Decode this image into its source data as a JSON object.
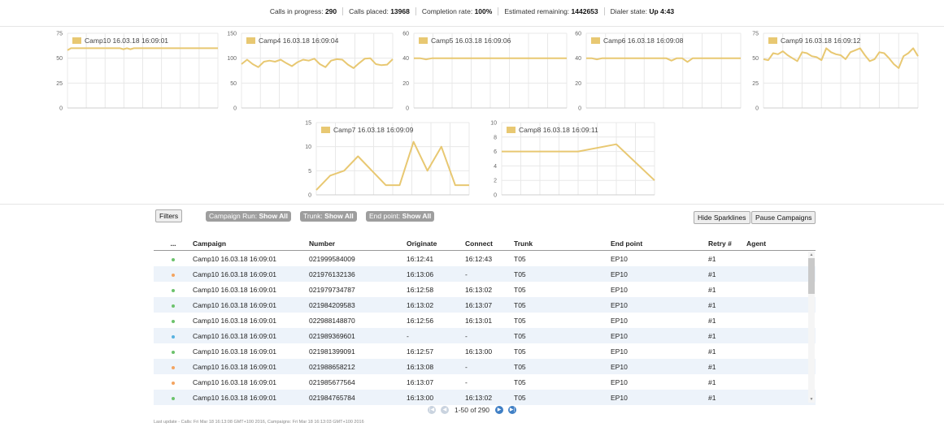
{
  "status": {
    "calls_in_progress_label": "Calls in progress:",
    "calls_in_progress": "290",
    "calls_placed_label": "Calls placed:",
    "calls_placed": "13968",
    "completion_rate_label": "Completion rate:",
    "completion_rate": "100%",
    "estimated_remaining_label": "Estimated remaining:",
    "estimated_remaining": "1442653",
    "dialer_state_label": "Dialer state:",
    "dialer_state": "Up 4:43"
  },
  "sparklines": [
    {
      "legend": "Camp10 16.03.18 16:09:01",
      "ymax": 75,
      "yticks": [
        0,
        25,
        50,
        75
      ],
      "color": "#e8c872",
      "values": [
        58,
        60,
        60,
        60,
        60,
        60,
        60,
        60,
        60,
        60,
        60,
        60,
        60,
        60,
        60,
        60,
        59,
        60,
        59,
        60,
        60,
        60,
        60,
        60,
        60,
        60,
        60,
        60,
        60,
        60,
        60,
        60,
        60,
        60,
        60,
        60,
        60,
        60,
        60,
        60,
        60,
        60,
        60,
        60
      ]
    },
    {
      "legend": "Camp4 16.03.18 16:09:04",
      "ymax": 150,
      "yticks": [
        0,
        50,
        100,
        150
      ],
      "color": "#e8c872",
      "values": [
        88,
        97,
        88,
        82,
        93,
        95,
        93,
        97,
        90,
        84,
        92,
        97,
        95,
        99,
        88,
        82,
        95,
        98,
        97,
        87,
        80,
        90,
        99,
        100,
        88,
        86,
        87,
        98
      ]
    },
    {
      "legend": "Camp5 16.03.18 16:09:06",
      "ymax": 60,
      "yticks": [
        0,
        20,
        40,
        60
      ],
      "color": "#e8c872",
      "values": [
        40,
        40,
        39,
        40,
        40,
        40,
        40,
        40,
        40,
        40,
        40,
        40,
        40,
        40,
        40,
        40,
        40,
        40,
        40,
        40,
        40,
        40,
        40,
        40,
        40,
        40
      ]
    },
    {
      "legend": "Camp6 16.03.18 16:09:08",
      "ymax": 60,
      "yticks": [
        0,
        20,
        40,
        60
      ],
      "color": "#e8c872",
      "values": [
        40,
        40,
        39,
        40,
        40,
        40,
        40,
        40,
        40,
        40,
        40,
        40,
        40,
        40,
        40,
        40,
        38,
        40,
        40,
        37,
        40,
        40,
        40,
        40,
        40,
        40,
        40,
        40,
        40,
        40
      ]
    },
    {
      "legend": "Camp9 16.03.18 16:09:12",
      "ymax": 75,
      "yticks": [
        0,
        25,
        50,
        75
      ],
      "color": "#e8c872",
      "values": [
        49,
        48,
        55,
        54,
        57,
        53,
        50,
        47,
        56,
        55,
        52,
        51,
        48,
        60,
        56,
        54,
        53,
        49,
        56,
        58,
        60,
        53,
        47,
        49,
        56,
        55,
        50,
        44,
        40,
        52,
        55,
        60,
        52
      ]
    },
    {
      "legend": "Camp7 16.03.18 16:09:09",
      "ymax": 15,
      "yticks": [
        0,
        5,
        10,
        15
      ],
      "color": "#e8c872",
      "values": [
        1,
        4,
        5,
        8,
        5,
        2,
        2,
        11,
        5,
        10,
        2,
        2
      ]
    },
    {
      "legend": "Camp8 16.03.18 16:09:11",
      "ymax": 10,
      "yticks": [
        0,
        2,
        4,
        6,
        8,
        10
      ],
      "color": "#e8c872",
      "values": [
        6,
        6,
        6,
        7,
        2
      ]
    }
  ],
  "filters": {
    "button_label": "Filters",
    "campaign_run_label": "Campaign Run:",
    "campaign_run_value": "Show All",
    "trunk_label": "Trunk:",
    "trunk_value": "Show All",
    "end_point_label": "End point:",
    "end_point_value": "Show All"
  },
  "actions": {
    "hide_sparklines": "Hide Sparklines",
    "pause_campaigns": "Pause Campaigns"
  },
  "table": {
    "columns": [
      "...",
      "Campaign",
      "Number",
      "Originate",
      "Connect",
      "Trunk",
      "End point",
      "Retry #",
      "Agent"
    ],
    "rows": [
      {
        "status": "green",
        "campaign": "Camp10 16.03.18 16:09:01",
        "number": "021999584009",
        "originate": "16:12:41",
        "connect": "16:12:43",
        "trunk": "T05",
        "endpoint": "EP10",
        "retry": "#1",
        "agent": ""
      },
      {
        "status": "orange",
        "campaign": "Camp10 16.03.18 16:09:01",
        "number": "021976132136",
        "originate": "16:13:06",
        "connect": "-",
        "trunk": "T05",
        "endpoint": "EP10",
        "retry": "#1",
        "agent": ""
      },
      {
        "status": "green",
        "campaign": "Camp10 16.03.18 16:09:01",
        "number": "021979734787",
        "originate": "16:12:58",
        "connect": "16:13:02",
        "trunk": "T05",
        "endpoint": "EP10",
        "retry": "#1",
        "agent": ""
      },
      {
        "status": "green",
        "campaign": "Camp10 16.03.18 16:09:01",
        "number": "021984209583",
        "originate": "16:13:02",
        "connect": "16:13:07",
        "trunk": "T05",
        "endpoint": "EP10",
        "retry": "#1",
        "agent": ""
      },
      {
        "status": "green",
        "campaign": "Camp10 16.03.18 16:09:01",
        "number": "022988148870",
        "originate": "16:12:56",
        "connect": "16:13:01",
        "trunk": "T05",
        "endpoint": "EP10",
        "retry": "#1",
        "agent": ""
      },
      {
        "status": "blue",
        "campaign": "Camp10 16.03.18 16:09:01",
        "number": "021989369601",
        "originate": "-",
        "connect": "-",
        "trunk": "T05",
        "endpoint": "EP10",
        "retry": "#1",
        "agent": ""
      },
      {
        "status": "green",
        "campaign": "Camp10 16.03.18 16:09:01",
        "number": "021981399091",
        "originate": "16:12:57",
        "connect": "16:13:00",
        "trunk": "T05",
        "endpoint": "EP10",
        "retry": "#1",
        "agent": ""
      },
      {
        "status": "orange",
        "campaign": "Camp10 16.03.18 16:09:01",
        "number": "021988658212",
        "originate": "16:13:08",
        "connect": "-",
        "trunk": "T05",
        "endpoint": "EP10",
        "retry": "#1",
        "agent": ""
      },
      {
        "status": "orange",
        "campaign": "Camp10 16.03.18 16:09:01",
        "number": "021985677564",
        "originate": "16:13:07",
        "connect": "-",
        "trunk": "T05",
        "endpoint": "EP10",
        "retry": "#1",
        "agent": ""
      },
      {
        "status": "green",
        "campaign": "Camp10 16.03.18 16:09:01",
        "number": "021984765784",
        "originate": "16:13:00",
        "connect": "16:13:02",
        "trunk": "T05",
        "endpoint": "EP10",
        "retry": "#1",
        "agent": ""
      }
    ]
  },
  "pager": {
    "text": "1-50 of 290",
    "first_icon": "first-page-icon",
    "prev_icon": "prev-page-icon",
    "next_icon": "next-page-icon",
    "last_icon": "last-page-icon"
  },
  "last_update": "Last update - Calls: Fri Mar 18 16:13:08 GMT+100 2016, Campaigns: Fri Mar 18 16:13:03 GMT+100 2016"
}
